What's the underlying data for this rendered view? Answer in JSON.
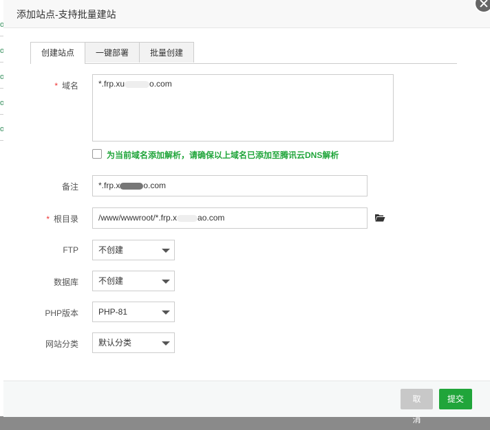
{
  "dialog": {
    "title": "添加站点-支持批量建站"
  },
  "backdrop": {
    "glyph": "o"
  },
  "tabs": [
    {
      "label": "创建站点",
      "active": true
    },
    {
      "label": "一键部署",
      "active": false
    },
    {
      "label": "批量创建",
      "active": false
    }
  ],
  "form": {
    "domain": {
      "label": "域名",
      "required": true,
      "value_prefix": "*.frp.xu",
      "value_suffix": "o.com"
    },
    "dns_checkbox": {
      "checked": false,
      "label": "为当前域名添加解析，请确保以上域名已添加至腾讯云DNS解析"
    },
    "remark": {
      "label": "备注",
      "value_prefix": "*.frp.x",
      "value_suffix": "o.com"
    },
    "root_dir": {
      "label": "根目录",
      "required": true,
      "value_prefix": "/www/wwwroot/*.frp.x",
      "value_suffix": "ao.com"
    },
    "ftp": {
      "label": "FTP",
      "selected": "不创建"
    },
    "database": {
      "label": "数据库",
      "selected": "不创建"
    },
    "php_version": {
      "label": "PHP版本",
      "selected": "PHP-81"
    },
    "site_category": {
      "label": "网站分类",
      "selected": "默认分类"
    }
  },
  "footer": {
    "cancel_label": "取消",
    "submit_label": "提交"
  },
  "colors": {
    "accent": "#20a53a",
    "required": "#e33333",
    "cancel": "#c8c8c8"
  }
}
